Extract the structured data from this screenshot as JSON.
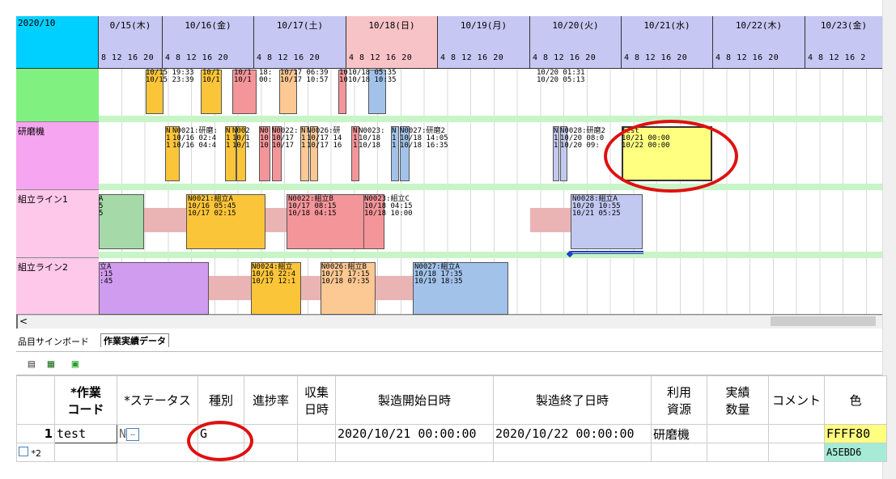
{
  "gantt": {
    "year_month": "2020/10",
    "days": [
      {
        "label": "0/15(木)",
        "hours": "8  12 16 20"
      },
      {
        "label": "10/16(金)",
        "hours": "4  8  12 16 20"
      },
      {
        "label": "10/17(土)",
        "hours": "4  8  12 16 20"
      },
      {
        "label": "10/18(日)",
        "hours": "4  8  12 16 20"
      },
      {
        "label": "10/19(月)",
        "hours": "4  8  12 16 20"
      },
      {
        "label": "10/20(火)",
        "hours": "4  8  12 16 20"
      },
      {
        "label": "10/21(水)",
        "hours": "4  8  12 16 20"
      },
      {
        "label": "10/22(木)",
        "hours": "4  8  12 16 20"
      },
      {
        "label": "10/23(金)",
        "hours": "4  8  12 16 2"
      }
    ],
    "rows": [
      {
        "label": ""
      },
      {
        "label": "研磨機"
      },
      {
        "label": "組立ライン1"
      },
      {
        "label": "組立ライン2"
      }
    ],
    "row1_texts": {
      "a": "10/15 19:33\n10/15 23:39",
      "b": "10/1\n10/1",
      "c": "10/1\n10/1",
      "d": "18:\n00:",
      "e": "10/17 06:39\n10/17 10:57",
      "f": "10\n10",
      "g": "10/18 05:35\n10/18 10:35",
      "h": "10/20 01:31\n10/20 05:13"
    },
    "row2_texts": {
      "a": "N\n1\n1",
      "b": "N0021:研磨:\n10/16 02:4\n10/16 04:4",
      "c": "N\n1\n1",
      "d": "N002\n10/1\n10/1",
      "e": "N0\n10\n10",
      "f": "N0022:\n10/17\n10/17",
      "g": "N\n1\n1",
      "h": "N0026:研\n10/17 14\n10/17 16",
      "i": "N\n1\n1",
      "j": "N0023:\n10/18\n10/18",
      "k": "N\n1\n1",
      "l": "N0027:研磨2\n10/18 14:05\n10/18 16:35",
      "m": "N\n1\n1",
      "n": "N0028:研磨2\n10/20 08:0\n10/20 09:",
      "test": "test\n10/21 00:00\n10/22 00:00"
    },
    "row3_texts": {
      "a": "A\n5\n5",
      "b": "N0021:組立A\n10/16 05:45\n10/17 02:15",
      "c": "N0022:組立B\n10/17 08:15\n10/18 04:15",
      "d": "N0023:組立C\n10/18 04:15\n10/18 10:00",
      "e": "N0028:組立A\n10/20 10:55\n10/21 05:25"
    },
    "row4_texts": {
      "a": "立A\n:15\n:45",
      "b": "N0024:組立\n10/16 22:4\n10/17 12:1",
      "c": "N0026:組立B\n10/17 17:15\n10/18 07:35",
      "d": "N0027:組立A\n10/18 17:35\n10/19 18:35"
    },
    "scroll_left": "<"
  },
  "tabs": {
    "board": "品目サインボード",
    "results": "作業実績データ"
  },
  "table": {
    "headers": [
      "",
      "*作業\nコード",
      "*ステータス",
      "種別",
      "進捗率",
      "収集\n日時",
      "製造開始日時",
      "製造終了日時",
      "利用\n資源",
      "実績\n数量",
      "コメント",
      "色"
    ],
    "rows": [
      {
        "num": "1",
        "code": "test",
        "status": "N",
        "type": "G",
        "progress": "",
        "collect": "",
        "start": "2020/10/21 00:00:00",
        "end": "2020/10/22 00:00:00",
        "resource": "研磨機",
        "qty": "",
        "comment": "",
        "color": "FFFF80"
      },
      {
        "num": "*2",
        "code": "",
        "status": "",
        "type": "",
        "progress": "",
        "collect": "",
        "start": "",
        "end": "",
        "resource": "",
        "qty": "",
        "comment": "",
        "color": "A5EBD6"
      }
    ]
  },
  "colors": {
    "orange": "#fbc53a",
    "pink": "#f4959a",
    "peach": "#fcc893",
    "blue": "#a2c2ea",
    "yellow": "#ffff80",
    "lavender": "#c2c9f1",
    "green": "#a5d9a8",
    "purple": "#d09cf0",
    "red_annotation": "#e01010"
  }
}
